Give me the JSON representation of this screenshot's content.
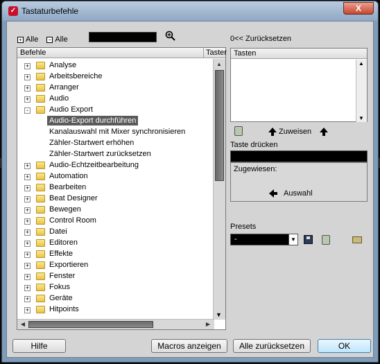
{
  "window": {
    "title": "Tastaturbefehle",
    "close_label": "X",
    "title_icon": "cubase-logo-icon"
  },
  "toolbar": {
    "expand_all": "Alle",
    "collapse_all": "Alle",
    "search_value": "",
    "search_icon": "magnifier-icon"
  },
  "tree": {
    "col_befehle": "Befehle",
    "col_tasten": "Taster",
    "items": [
      {
        "label": "Analyse",
        "level": 0,
        "expander": "+"
      },
      {
        "label": "Arbeitsbereiche",
        "level": 0,
        "expander": "+"
      },
      {
        "label": "Arranger",
        "level": 0,
        "expander": "+"
      },
      {
        "label": "Audio",
        "level": 0,
        "expander": "+"
      },
      {
        "label": "Audio Export",
        "level": 0,
        "expander": "-"
      },
      {
        "label": "Audio-Export durchführen",
        "level": 1,
        "selected": true
      },
      {
        "label": "Kanalauswahl mit Mixer synchronisieren",
        "level": 1
      },
      {
        "label": "Zähler-Startwert erhöhen",
        "level": 1
      },
      {
        "label": "Zähler-Startwert zurücksetzen",
        "level": 1
      },
      {
        "label": "Audio-Echtzeitbearbeitung",
        "level": 0,
        "expander": "+"
      },
      {
        "label": "Automation",
        "level": 0,
        "expander": "+"
      },
      {
        "label": "Bearbeiten",
        "level": 0,
        "expander": "+"
      },
      {
        "label": "Beat Designer",
        "level": 0,
        "expander": "+"
      },
      {
        "label": "Bewegen",
        "level": 0,
        "expander": "+"
      },
      {
        "label": "Control Room",
        "level": 0,
        "expander": "+"
      },
      {
        "label": "Datei",
        "level": 0,
        "expander": "+"
      },
      {
        "label": "Editoren",
        "level": 0,
        "expander": "+"
      },
      {
        "label": "Effekte",
        "level": 0,
        "expander": "+"
      },
      {
        "label": "Exportieren",
        "level": 0,
        "expander": "+"
      },
      {
        "label": "Fenster",
        "level": 0,
        "expander": "+"
      },
      {
        "label": "Fokus",
        "level": 0,
        "expander": "+"
      },
      {
        "label": "Geräte",
        "level": 0,
        "expander": "+"
      },
      {
        "label": "Hitpoints",
        "level": 0,
        "expander": "+"
      }
    ]
  },
  "right": {
    "reset_label": "0<< Zurücksetzen",
    "tasten_header": "Tasten",
    "assign_label": "Zuweisen",
    "press_key_label": "Taste drücken",
    "press_key_value": "",
    "assigned_label": "Zugewiesen:",
    "select_label": "Auswahl",
    "presets_label": "Presets",
    "presets_value": "-"
  },
  "buttons": {
    "help": "Hilfe",
    "macros": "Macros anzeigen",
    "reset_all": "Alle zurücksetzen",
    "ok": "OK"
  },
  "colors": {
    "selection": "#5a5a5a",
    "folder": "#f0d060",
    "ok_border": "#3c7fb1"
  }
}
